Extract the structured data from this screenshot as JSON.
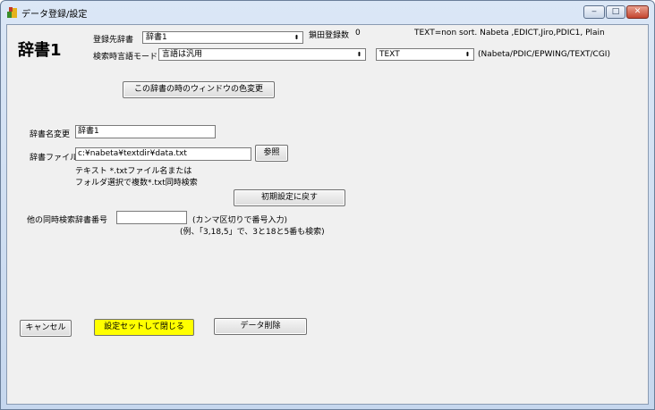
{
  "window": {
    "title": "データ登録/設定",
    "minimize_label": "‒",
    "maximize_label": "□",
    "close_label": "✕"
  },
  "header": {
    "dict_name_display": "辞書1",
    "target_dict_label": "登録先辞書",
    "target_dict_value": "辞書1",
    "registered_count_label": "鎖田登録数",
    "registered_count_value": "0",
    "format_note": "TEXT=non sort. Nabeta ,EDICT,Jiro,PDIC1, Plain",
    "search_mode_label": "検索時言語モード",
    "search_mode_value": "言語は汎用",
    "format_value": "TEXT",
    "format_options_note": "(Nabeta/PDIC/EPWING/TEXT/CGI)"
  },
  "buttons": {
    "window_color": "この辞書の時のウィンドウの色変更",
    "browse": "参照",
    "reset": "初期設定に戻す",
    "cancel": "キャンセル",
    "save_close": "設定セットして閉じる",
    "delete_data": "データ削除"
  },
  "form": {
    "rename_label": "辞書名変更",
    "rename_value": "辞書1",
    "file_label": "辞書ファイル",
    "file_value": "c:¥nabeta¥textdir¥data.txt",
    "file_hint_1": "テキスト *.txtファイル名または",
    "file_hint_2": "フォルダ選択で複数*.txt同時検索",
    "other_dicts_label": "他の同時検索辞書番号",
    "other_dicts_value": "",
    "other_dicts_hint": "(カンマ区切りで番号入力)",
    "other_dicts_example": "(例、「3,18,5」で、3と18と5番も検索)"
  },
  "colors": {
    "accent_yellow": "#ffff00",
    "close_button": "#c4452f"
  }
}
